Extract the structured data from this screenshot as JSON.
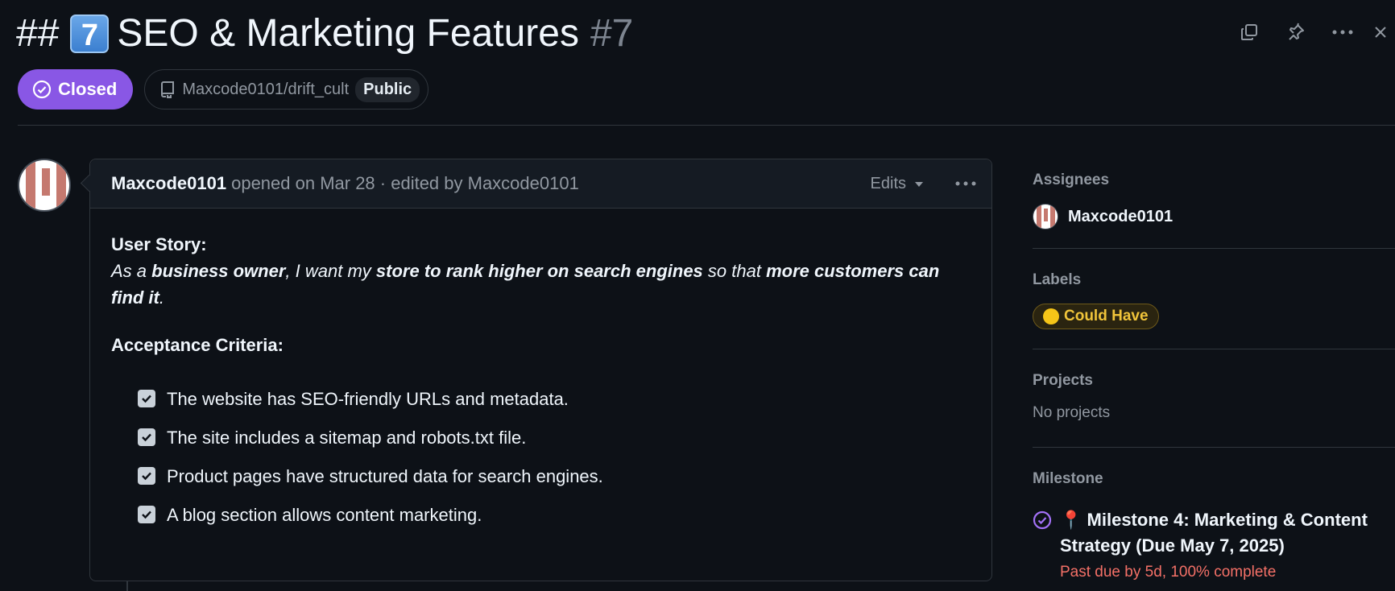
{
  "header": {
    "title_prefix": "##",
    "title_emoji": "7",
    "title_text": "SEO & Marketing Features",
    "issue_number": "#7",
    "state": "Closed",
    "repo": "Maxcode0101/drift_cult",
    "visibility": "Public",
    "actions": [
      "copy-icon",
      "pin-icon",
      "more-icon",
      "close-icon"
    ]
  },
  "comment": {
    "author": "Maxcode0101",
    "meta": "opened on Mar 28 · edited by Maxcode0101",
    "edits_label": "Edits",
    "story_heading": "User Story:",
    "story": {
      "t1": "As a ",
      "b1": "business owner",
      "t2": ", I want my ",
      "b2": "store to rank higher on search engines",
      "t3": " so that ",
      "b3": "more customers can find it",
      "t4": "."
    },
    "criteria_heading": "Acceptance Criteria:",
    "tasks": [
      {
        "text": "The website has SEO-friendly URLs and metadata.",
        "checked": true
      },
      {
        "text": "The site includes a sitemap and robots.txt file.",
        "checked": true
      },
      {
        "text": "Product pages have structured data for search engines.",
        "checked": true
      },
      {
        "text": "A blog section allows content marketing.",
        "checked": true
      }
    ]
  },
  "sidebar": {
    "assignees_heading": "Assignees",
    "assignee": "Maxcode0101",
    "labels_heading": "Labels",
    "label": "Could Have",
    "label_color": "#f5c518",
    "projects_heading": "Projects",
    "projects_value": "No projects",
    "milestone_heading": "Milestone",
    "milestone_title": "Milestone 4: Marketing & Content Strategy (Due May 7, 2025)",
    "milestone_status": "Past due by 5d, 100% complete"
  },
  "colors": {
    "closed": "#8957e5",
    "background": "#0d1117",
    "overdue": "#f47067"
  }
}
